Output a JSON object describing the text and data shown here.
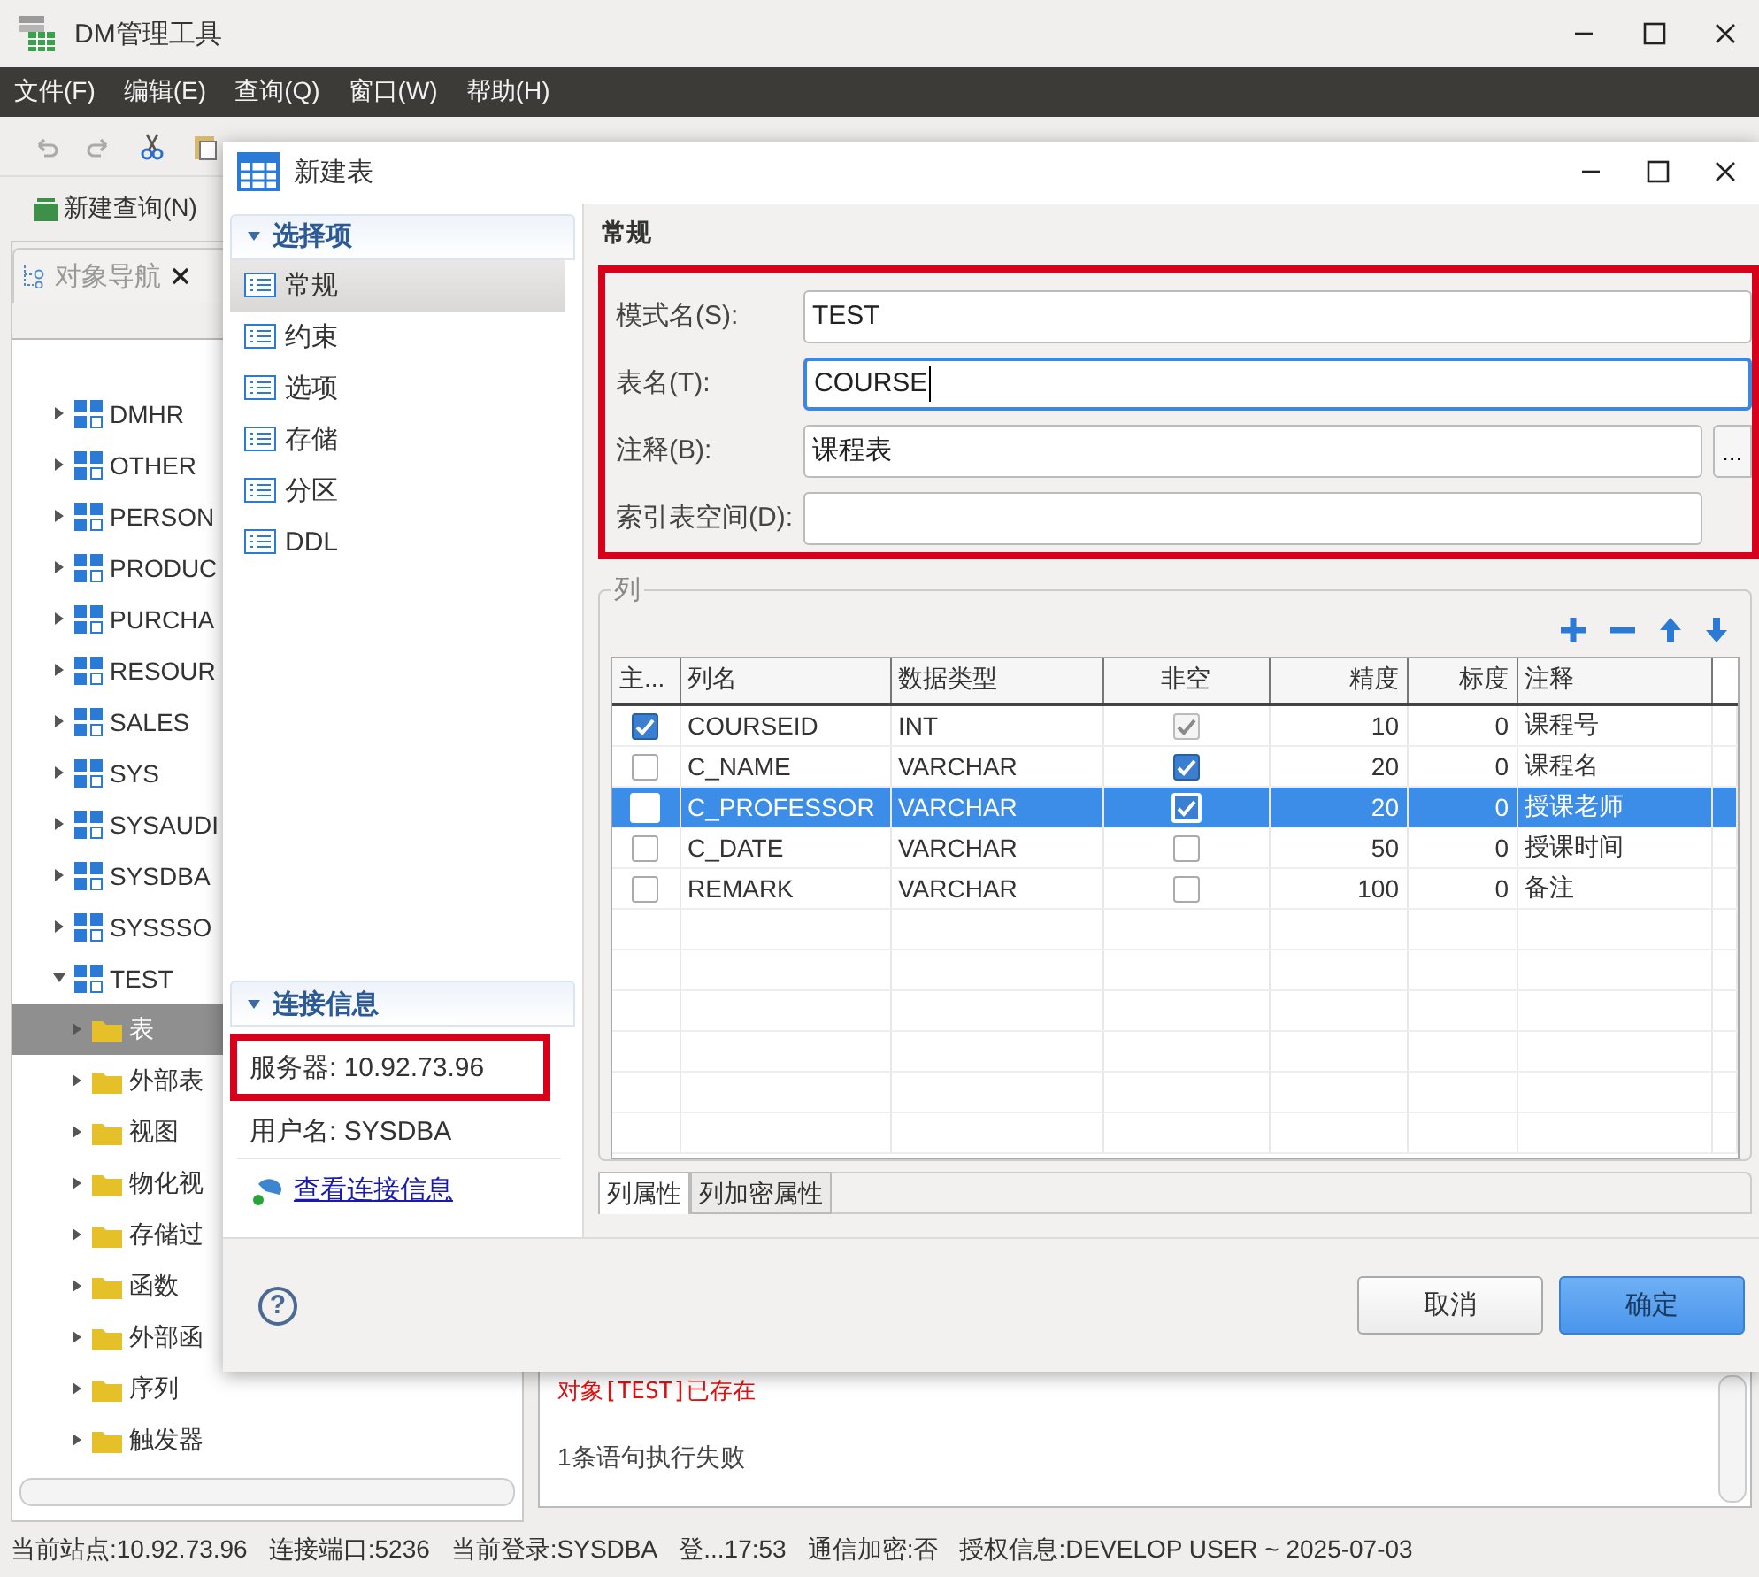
{
  "app": {
    "title": "DM管理工具"
  },
  "menu": [
    "文件(F)",
    "编辑(E)",
    "查询(Q)",
    "窗口(W)",
    "帮助(H)"
  ],
  "toolbar": {
    "new_query": "新建查询(N)"
  },
  "navigator": {
    "tab": "对象导航",
    "items": [
      {
        "label": "DMHR",
        "kind": "schema",
        "expanded": false,
        "selected": false
      },
      {
        "label": "OTHER",
        "kind": "schema",
        "expanded": false,
        "selected": false
      },
      {
        "label": "PERSON",
        "kind": "schema",
        "expanded": false,
        "selected": false
      },
      {
        "label": "PRODUC",
        "kind": "schema",
        "expanded": false,
        "selected": false
      },
      {
        "label": "PURCHA",
        "kind": "schema",
        "expanded": false,
        "selected": false
      },
      {
        "label": "RESOUR",
        "kind": "schema",
        "expanded": false,
        "selected": false
      },
      {
        "label": "SALES",
        "kind": "schema",
        "expanded": false,
        "selected": false
      },
      {
        "label": "SYS",
        "kind": "schema",
        "expanded": false,
        "selected": false
      },
      {
        "label": "SYSAUDI",
        "kind": "schema",
        "expanded": false,
        "selected": false
      },
      {
        "label": "SYSDBA",
        "kind": "schema",
        "expanded": false,
        "selected": false
      },
      {
        "label": "SYSSSO",
        "kind": "schema",
        "expanded": false,
        "selected": false
      },
      {
        "label": "TEST",
        "kind": "schema",
        "expanded": true,
        "selected": false,
        "children": [
          {
            "label": "表",
            "kind": "folder",
            "expanded": false,
            "selected": true
          },
          {
            "label": "外部表",
            "kind": "folder",
            "expanded": false,
            "selected": false
          },
          {
            "label": "视图",
            "kind": "folder",
            "expanded": false,
            "selected": false
          },
          {
            "label": "物化视",
            "kind": "folder",
            "expanded": false,
            "selected": false
          },
          {
            "label": "存储过",
            "kind": "folder",
            "expanded": false,
            "selected": false
          },
          {
            "label": "函数",
            "kind": "folder",
            "expanded": false,
            "selected": false
          },
          {
            "label": "外部函",
            "kind": "folder",
            "expanded": false,
            "selected": false
          },
          {
            "label": "序列",
            "kind": "folder",
            "expanded": false,
            "selected": false
          },
          {
            "label": "触发器",
            "kind": "folder",
            "expanded": false,
            "selected": false
          }
        ]
      }
    ]
  },
  "log": {
    "lines": [
      {
        "text": "对象[TEST]已存在",
        "kind": "error"
      },
      {
        "text": "1条语句执行失败",
        "kind": "info"
      }
    ]
  },
  "status_bar": [
    "当前站点:10.92.73.96",
    "连接端口:5236",
    "当前登录:SYSDBA",
    "登...17:53",
    "通信加密:否",
    "授权信息:DEVELOP USER ~ 2025-07-03"
  ],
  "dialog": {
    "title": "新建表",
    "options_header": "选择项",
    "options": [
      {
        "label": "常规",
        "selected": true
      },
      {
        "label": "约束",
        "selected": false
      },
      {
        "label": "选项",
        "selected": false
      },
      {
        "label": "存储",
        "selected": false
      },
      {
        "label": "分区",
        "selected": false
      },
      {
        "label": "DDL",
        "selected": false
      }
    ],
    "connection_header": "连接信息",
    "server": "服务器: 10.92.73.96",
    "user": "用户名: SYSDBA",
    "link": "查看连接信息",
    "section_title": "常规",
    "fields": [
      {
        "label": "模式名(S):",
        "value": "TEST",
        "focused": false,
        "kind": "full"
      },
      {
        "label": "表名(T):",
        "value": "COURSE",
        "focused": true,
        "kind": "full"
      },
      {
        "label": "注释(B):",
        "value": "课程表",
        "focused": false,
        "kind": "button",
        "button": "..."
      },
      {
        "label": "索引表空间(D):",
        "focused": false,
        "kind": "short"
      }
    ],
    "columns_group": "列",
    "table": {
      "columns": [
        "主...",
        "列名",
        "数据类型",
        "非空",
        "精度",
        "标度",
        "注释"
      ],
      "rows": [
        {
          "primary_key": true,
          "name": "COURSEID",
          "type": "INT",
          "not_null": true,
          "not_null_disabled": true,
          "precision": "10",
          "scale": "0",
          "comment": "课程号",
          "selected": false
        },
        {
          "primary_key": false,
          "name": "C_NAME",
          "type": "VARCHAR",
          "not_null": true,
          "not_null_disabled": false,
          "precision": "20",
          "scale": "0",
          "comment": "课程名",
          "selected": false
        },
        {
          "primary_key": false,
          "name": "C_PROFESSOR",
          "type": "VARCHAR",
          "not_null": true,
          "not_null_disabled": false,
          "precision": "20",
          "scale": "0",
          "comment": "授课老师",
          "selected": true
        },
        {
          "primary_key": false,
          "name": "C_DATE",
          "type": "VARCHAR",
          "not_null": false,
          "not_null_disabled": false,
          "precision": "50",
          "scale": "0",
          "comment": "授课时间",
          "selected": false
        },
        {
          "primary_key": false,
          "name": "REMARK",
          "type": "VARCHAR",
          "not_null": false,
          "not_null_disabled": false,
          "precision": "100",
          "scale": "0",
          "comment": "备注",
          "selected": false
        }
      ]
    },
    "tabs": [
      {
        "label": "列属性",
        "selected": true
      },
      {
        "label": "列加密属性",
        "selected": false
      }
    ],
    "help": "?",
    "buttons": [
      {
        "label": "取消",
        "kind": "secondary"
      },
      {
        "label": "确定",
        "kind": "primary"
      }
    ]
  }
}
